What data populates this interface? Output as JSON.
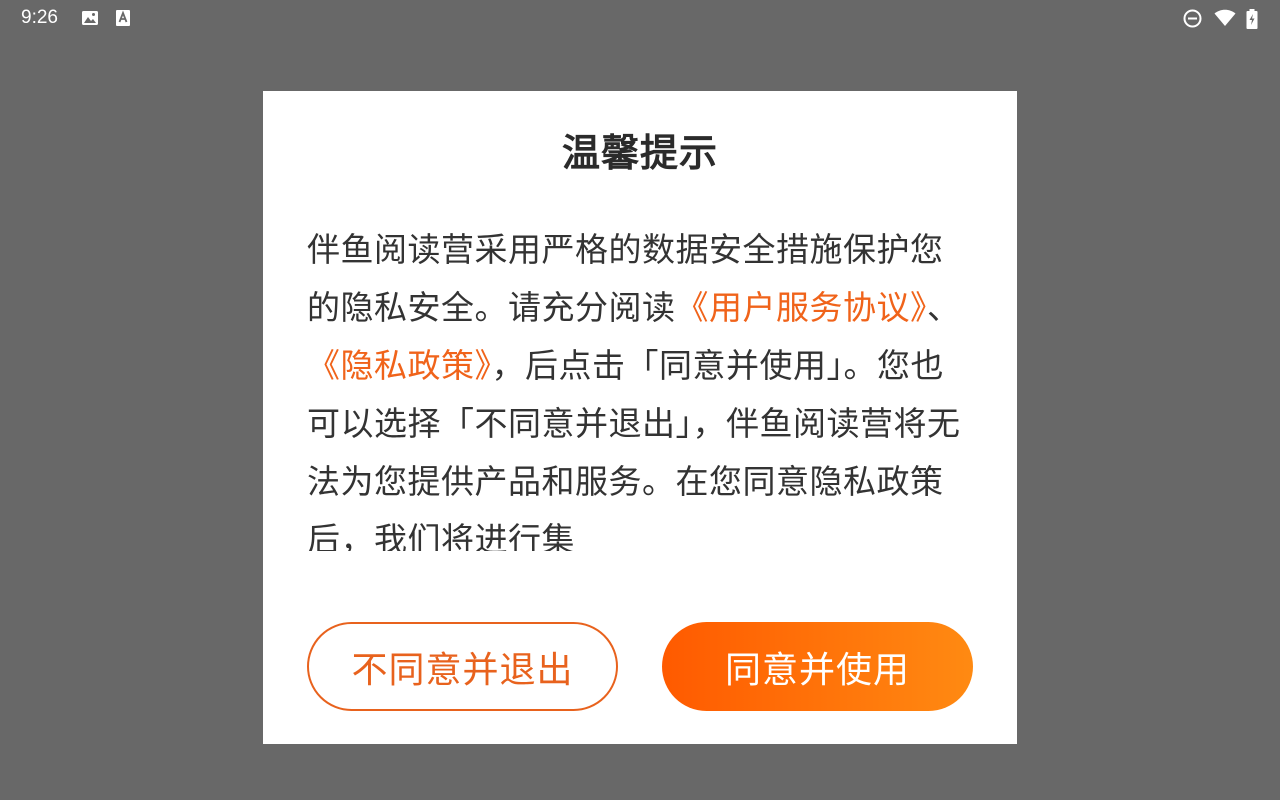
{
  "status_bar": {
    "time": "9:26",
    "icons": [
      "image-icon",
      "font-icon",
      "do-not-disturb-icon",
      "wifi-icon",
      "battery-icon"
    ]
  },
  "dialog": {
    "title": "温馨提示",
    "body": {
      "text1": "伴鱼阅读营采用严格的数据安全措施保护您的隐私安全。请充分阅读",
      "link_user_agreement": "《用户服务协议》",
      "text2": "、",
      "link_privacy_policy": "《隐私政策》",
      "text3": "，后点击「同意并使用」。您也可以选择「不同意并退出」，伴鱼阅读营将无法为您提供产品和服务。在您同意隐私政策后，我们将进行集"
    },
    "decline_button": "不同意并退出",
    "accept_button": "同意并使用"
  },
  "colors": {
    "overlay": "#686868",
    "accent": "#f0631a",
    "accent_gradient_start": "#ff5a00",
    "accent_gradient_end": "#ff8a12"
  }
}
